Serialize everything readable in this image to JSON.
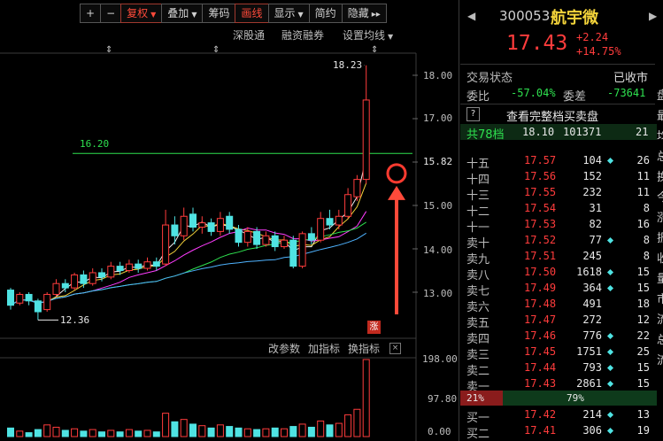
{
  "toolbar": {
    "buttons": [
      "+",
      "−",
      "复权",
      "叠加",
      "筹码",
      "画线",
      "显示",
      "简约",
      "隐藏"
    ],
    "more": "▸▸"
  },
  "subbar": {
    "shenguton": "深股通",
    "rongzi": "融资融券",
    "settings": "设置均线"
  },
  "chart": {
    "price_ticks": [
      "18.00",
      "17.00",
      "16.00",
      "15.00",
      "14.00",
      "13.00"
    ],
    "current_price_label": "15.82",
    "high_label": "18.23",
    "low_label": "12.36",
    "line_label": "16.20",
    "zhang": "涨",
    "markers": [
      "⇕",
      "⇕",
      "⇕"
    ]
  },
  "indicator_bar": {
    "params": "改参数",
    "add": "加指标",
    "change": "换指标",
    "close": "×"
  },
  "volume_ticks": [
    "198.00",
    "97.80",
    "0.00"
  ],
  "chart_data": {
    "type": "bar",
    "title": "",
    "ylabel": "",
    "ylim": [
      12.2,
      18.5
    ],
    "price_line": 16.2,
    "candles": [
      {
        "o": 13.05,
        "c": 12.7,
        "h": 13.1,
        "l": 12.6
      },
      {
        "o": 12.75,
        "c": 12.95,
        "h": 13.0,
        "l": 12.7
      },
      {
        "o": 12.95,
        "c": 12.8,
        "h": 13.0,
        "l": 12.7
      },
      {
        "o": 12.8,
        "c": 12.55,
        "h": 12.85,
        "l": 12.36
      },
      {
        "o": 12.6,
        "c": 12.95,
        "h": 13.0,
        "l": 12.55
      },
      {
        "o": 12.95,
        "c": 13.2,
        "h": 13.3,
        "l": 12.9
      },
      {
        "o": 13.2,
        "c": 13.1,
        "h": 13.3,
        "l": 13.0
      },
      {
        "o": 13.1,
        "c": 13.4,
        "h": 13.45,
        "l": 13.05
      },
      {
        "o": 13.4,
        "c": 13.2,
        "h": 13.5,
        "l": 13.1
      },
      {
        "o": 13.2,
        "c": 13.45,
        "h": 13.55,
        "l": 13.15
      },
      {
        "o": 13.45,
        "c": 13.35,
        "h": 13.55,
        "l": 13.25
      },
      {
        "o": 13.35,
        "c": 13.6,
        "h": 13.7,
        "l": 13.3
      },
      {
        "o": 13.6,
        "c": 13.5,
        "h": 13.7,
        "l": 13.4
      },
      {
        "o": 13.5,
        "c": 13.65,
        "h": 13.75,
        "l": 13.45
      },
      {
        "o": 13.65,
        "c": 13.55,
        "h": 13.75,
        "l": 13.45
      },
      {
        "o": 13.55,
        "c": 13.7,
        "h": 13.8,
        "l": 13.5
      },
      {
        "o": 13.7,
        "c": 13.6,
        "h": 13.8,
        "l": 13.5
      },
      {
        "o": 13.65,
        "c": 14.55,
        "h": 14.9,
        "l": 13.6
      },
      {
        "o": 14.55,
        "c": 14.3,
        "h": 14.75,
        "l": 14.1
      },
      {
        "o": 14.3,
        "c": 14.75,
        "h": 14.95,
        "l": 14.2
      },
      {
        "o": 14.8,
        "c": 14.5,
        "h": 14.95,
        "l": 14.4
      },
      {
        "o": 14.5,
        "c": 14.6,
        "h": 14.75,
        "l": 14.35
      },
      {
        "o": 14.6,
        "c": 14.4,
        "h": 14.7,
        "l": 14.3
      },
      {
        "o": 14.4,
        "c": 14.7,
        "h": 14.85,
        "l": 14.3
      },
      {
        "o": 14.75,
        "c": 14.45,
        "h": 14.85,
        "l": 14.35
      },
      {
        "o": 14.45,
        "c": 14.15,
        "h": 14.55,
        "l": 14.05
      },
      {
        "o": 14.15,
        "c": 14.4,
        "h": 14.5,
        "l": 14.05
      },
      {
        "o": 14.4,
        "c": 14.1,
        "h": 14.5,
        "l": 14.0
      },
      {
        "o": 14.1,
        "c": 14.3,
        "h": 14.4,
        "l": 14.05
      },
      {
        "o": 14.3,
        "c": 14.05,
        "h": 14.4,
        "l": 13.95
      },
      {
        "o": 14.05,
        "c": 14.2,
        "h": 14.3,
        "l": 14.0
      },
      {
        "o": 14.2,
        "c": 13.6,
        "h": 14.3,
        "l": 13.55
      },
      {
        "o": 13.6,
        "c": 14.35,
        "h": 14.4,
        "l": 13.55
      },
      {
        "o": 14.35,
        "c": 14.2,
        "h": 14.5,
        "l": 14.1
      },
      {
        "o": 14.2,
        "c": 14.7,
        "h": 14.85,
        "l": 14.15
      },
      {
        "o": 14.7,
        "c": 14.55,
        "h": 14.9,
        "l": 14.45
      },
      {
        "o": 14.55,
        "c": 14.75,
        "h": 14.9,
        "l": 14.45
      },
      {
        "o": 14.75,
        "c": 15.25,
        "h": 15.4,
        "l": 14.7
      },
      {
        "o": 15.2,
        "c": 15.6,
        "h": 15.7,
        "l": 15.1
      },
      {
        "o": 15.6,
        "c": 17.43,
        "h": 18.23,
        "l": 15.5
      }
    ],
    "volumes": [
      22,
      14,
      10,
      18,
      30,
      24,
      16,
      20,
      14,
      18,
      12,
      16,
      12,
      18,
      14,
      16,
      12,
      60,
      38,
      44,
      32,
      28,
      22,
      30,
      26,
      22,
      20,
      18,
      20,
      22,
      20,
      26,
      32,
      24,
      40,
      30,
      34,
      56,
      70,
      198
    ]
  },
  "quote": {
    "code": "300053",
    "name": "航宇微",
    "price": "17.43",
    "change": "+2.24",
    "pct": "+14.75%",
    "status_label": "交易状态",
    "status_value": "已收市",
    "weibi_label": "委比",
    "weibi_value": "-57.04%",
    "weicha_label": "委差",
    "weicha_value": "-73641",
    "qmark": "?",
    "full_depth": "查看完整档买卖盘",
    "total_label": "共78档",
    "total_price": "18.10",
    "total_vol": "101371",
    "total_cnt": "21",
    "bar_left": "21%",
    "bar_right": "79%",
    "side_chars": [
      "盘",
      "最",
      "均",
      "总",
      "换",
      "今",
      "涨",
      "振",
      "收",
      "量",
      "市",
      "流",
      "总",
      "流"
    ]
  },
  "asks": [
    {
      "label": "十五",
      "price": "17.57",
      "vol": "104",
      "dot": true,
      "cnt": "26"
    },
    {
      "label": "十四",
      "price": "17.56",
      "vol": "152",
      "dot": false,
      "cnt": "11"
    },
    {
      "label": "十三",
      "price": "17.55",
      "vol": "232",
      "dot": false,
      "cnt": "11"
    },
    {
      "label": "十二",
      "price": "17.54",
      "vol": "31",
      "dot": false,
      "cnt": "8"
    },
    {
      "label": "十一",
      "price": "17.53",
      "vol": "82",
      "dot": false,
      "cnt": "16"
    },
    {
      "label": "卖十",
      "price": "17.52",
      "vol": "77",
      "dot": true,
      "cnt": "8"
    },
    {
      "label": "卖九",
      "price": "17.51",
      "vol": "245",
      "dot": false,
      "cnt": "8"
    },
    {
      "label": "卖八",
      "price": "17.50",
      "vol": "1618",
      "dot": true,
      "cnt": "15"
    },
    {
      "label": "卖七",
      "price": "17.49",
      "vol": "364",
      "dot": true,
      "cnt": "15"
    },
    {
      "label": "卖六",
      "price": "17.48",
      "vol": "491",
      "dot": false,
      "cnt": "18"
    },
    {
      "label": "卖五",
      "price": "17.47",
      "vol": "272",
      "dot": false,
      "cnt": "12"
    },
    {
      "label": "卖四",
      "price": "17.46",
      "vol": "776",
      "dot": true,
      "cnt": "22"
    },
    {
      "label": "卖三",
      "price": "17.45",
      "vol": "1751",
      "dot": true,
      "cnt": "25"
    },
    {
      "label": "卖二",
      "price": "17.44",
      "vol": "793",
      "dot": true,
      "cnt": "15"
    },
    {
      "label": "卖一",
      "price": "17.43",
      "vol": "2861",
      "dot": true,
      "cnt": "15"
    }
  ],
  "bids": [
    {
      "label": "买一",
      "price": "17.42",
      "vol": "214",
      "dot": true,
      "cnt": "13"
    },
    {
      "label": "买二",
      "price": "17.41",
      "vol": "306",
      "dot": true,
      "cnt": "19"
    }
  ]
}
